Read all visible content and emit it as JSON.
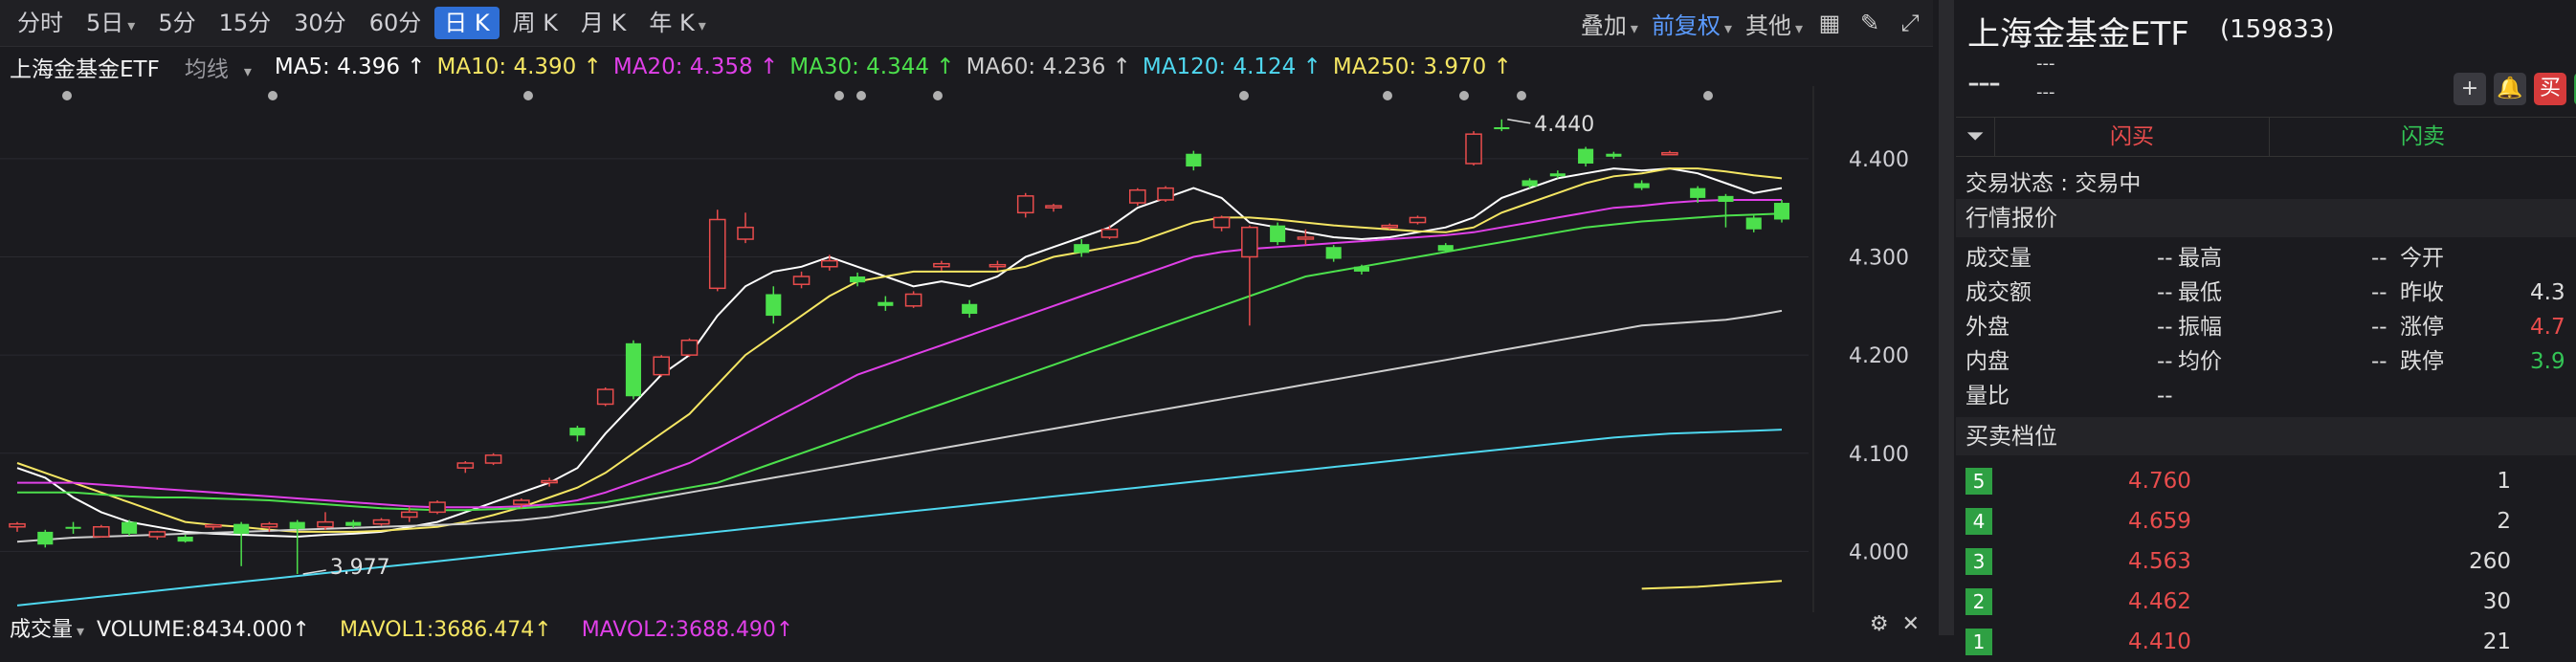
{
  "toolbar": {
    "periods": [
      "分时",
      "5日",
      "5分",
      "15分",
      "30分",
      "60分",
      "日 K",
      "周 K",
      "月 K",
      "年 K"
    ],
    "period_dropdowns": [
      false,
      true,
      false,
      false,
      false,
      false,
      false,
      false,
      false,
      true
    ],
    "active_period": "日 K",
    "overlay_label": "叠加",
    "adjust_label": "前复权",
    "other_label": "其他"
  },
  "ma_bar": {
    "stock_name": "上海金基金ETF",
    "line_type": "均线",
    "items": [
      {
        "label": "MA5: 4.396 ↑",
        "color": "#ffffff"
      },
      {
        "label": "MA10: 4.390 ↑",
        "color": "#f5e663"
      },
      {
        "label": "MA20: 4.358 ↑",
        "color": "#e040e8"
      },
      {
        "label": "MA30: 4.344 ↑",
        "color": "#4ce04c"
      },
      {
        "label": "MA60: 4.236 ↑",
        "color": "#cfcfcf"
      },
      {
        "label": "MA120: 4.124 ↑",
        "color": "#4fd8f0"
      },
      {
        "label": "MA250: 3.970 ↑",
        "color": "#f5e663"
      }
    ]
  },
  "chart_data": {
    "type": "candlestick",
    "ylim": [
      3.94,
      4.47
    ],
    "y_ticks": [
      "4.400",
      "4.300",
      "4.200",
      "4.100",
      "4.000"
    ],
    "y_tick_values": [
      4.4,
      4.3,
      4.2,
      4.1,
      4.0
    ],
    "high_annotation": "4.440",
    "low_annotation": "3.977",
    "candles": [
      {
        "o": 4.025,
        "c": 4.028,
        "h": 4.03,
        "l": 4.02
      },
      {
        "o": 4.02,
        "c": 4.007,
        "h": 4.022,
        "l": 4.004
      },
      {
        "o": 4.025,
        "c": 4.024,
        "h": 4.03,
        "l": 4.018
      },
      {
        "o": 4.015,
        "c": 4.025,
        "h": 4.027,
        "l": 4.014
      },
      {
        "o": 4.03,
        "c": 4.018,
        "h": 4.032,
        "l": 4.016
      },
      {
        "o": 4.015,
        "c": 4.02,
        "h": 4.021,
        "l": 4.012
      },
      {
        "o": 4.015,
        "c": 4.01,
        "h": 4.017,
        "l": 4.009
      },
      {
        "o": 4.025,
        "c": 4.027,
        "h": 4.028,
        "l": 4.022
      },
      {
        "o": 4.028,
        "c": 4.018,
        "h": 4.03,
        "l": 3.985
      },
      {
        "o": 4.025,
        "c": 4.028,
        "h": 4.03,
        "l": 4.02
      },
      {
        "o": 4.03,
        "c": 4.023,
        "h": 4.032,
        "l": 3.977
      },
      {
        "o": 4.025,
        "c": 4.03,
        "h": 4.04,
        "l": 4.022
      },
      {
        "o": 4.03,
        "c": 4.026,
        "h": 4.032,
        "l": 4.024
      },
      {
        "o": 4.028,
        "c": 4.032,
        "h": 4.034,
        "l": 4.026
      },
      {
        "o": 4.035,
        "c": 4.04,
        "h": 4.045,
        "l": 4.03
      },
      {
        "o": 4.04,
        "c": 4.05,
        "h": 4.052,
        "l": 4.038
      },
      {
        "o": 4.085,
        "c": 4.09,
        "h": 4.092,
        "l": 4.08
      },
      {
        "o": 4.09,
        "c": 4.098,
        "h": 4.1,
        "l": 4.088
      },
      {
        "o": 4.048,
        "c": 4.052,
        "h": 4.054,
        "l": 4.044
      },
      {
        "o": 4.07,
        "c": 4.072,
        "h": 4.075,
        "l": 4.066
      },
      {
        "o": 4.126,
        "c": 4.118,
        "h": 4.128,
        "l": 4.112
      },
      {
        "o": 4.15,
        "c": 4.165,
        "h": 4.167,
        "l": 4.148
      },
      {
        "o": 4.212,
        "c": 4.158,
        "h": 4.215,
        "l": 4.155
      },
      {
        "o": 4.18,
        "c": 4.198,
        "h": 4.2,
        "l": 4.178
      },
      {
        "o": 4.2,
        "c": 4.215,
        "h": 4.217,
        "l": 4.198
      },
      {
        "o": 4.268,
        "c": 4.338,
        "h": 4.348,
        "l": 4.265
      },
      {
        "o": 4.318,
        "c": 4.33,
        "h": 4.345,
        "l": 4.314
      },
      {
        "o": 4.262,
        "c": 4.24,
        "h": 4.27,
        "l": 4.232
      },
      {
        "o": 4.272,
        "c": 4.28,
        "h": 4.285,
        "l": 4.268
      },
      {
        "o": 4.29,
        "c": 4.296,
        "h": 4.302,
        "l": 4.286
      },
      {
        "o": 4.28,
        "c": 4.274,
        "h": 4.284,
        "l": 4.27
      },
      {
        "o": 4.254,
        "c": 4.25,
        "h": 4.26,
        "l": 4.245
      },
      {
        "o": 4.25,
        "c": 4.262,
        "h": 4.265,
        "l": 4.248
      },
      {
        "o": 4.29,
        "c": 4.293,
        "h": 4.296,
        "l": 4.286
      },
      {
        "o": 4.252,
        "c": 4.242,
        "h": 4.256,
        "l": 4.238
      },
      {
        "o": 4.29,
        "c": 4.292,
        "h": 4.296,
        "l": 4.286
      },
      {
        "o": 4.345,
        "c": 4.362,
        "h": 4.365,
        "l": 4.34
      },
      {
        "o": 4.35,
        "c": 4.352,
        "h": 4.354,
        "l": 4.346
      },
      {
        "o": 4.313,
        "c": 4.304,
        "h": 4.318,
        "l": 4.3
      },
      {
        "o": 4.32,
        "c": 4.328,
        "h": 4.332,
        "l": 4.318
      },
      {
        "o": 4.355,
        "c": 4.368,
        "h": 4.37,
        "l": 4.352
      },
      {
        "o": 4.358,
        "c": 4.37,
        "h": 4.372,
        "l": 4.356
      },
      {
        "o": 4.405,
        "c": 4.392,
        "h": 4.408,
        "l": 4.388
      },
      {
        "o": 4.33,
        "c": 4.34,
        "h": 4.342,
        "l": 4.326
      },
      {
        "o": 4.3,
        "c": 4.33,
        "h": 4.332,
        "l": 4.23
      },
      {
        "o": 4.332,
        "c": 4.315,
        "h": 4.335,
        "l": 4.312
      },
      {
        "o": 4.32,
        "c": 4.32,
        "h": 4.328,
        "l": 4.312
      },
      {
        "o": 4.31,
        "c": 4.298,
        "h": 4.312,
        "l": 4.295
      },
      {
        "o": 4.29,
        "c": 4.285,
        "h": 4.292,
        "l": 4.282
      },
      {
        "o": 4.33,
        "c": 4.332,
        "h": 4.334,
        "l": 4.328
      },
      {
        "o": 4.335,
        "c": 4.34,
        "h": 4.342,
        "l": 4.333
      },
      {
        "o": 4.312,
        "c": 4.306,
        "h": 4.314,
        "l": 4.304
      },
      {
        "o": 4.395,
        "c": 4.425,
        "h": 4.428,
        "l": 4.393
      },
      {
        "o": 4.432,
        "c": 4.43,
        "h": 4.44,
        "l": 4.428
      },
      {
        "o": 4.378,
        "c": 4.372,
        "h": 4.38,
        "l": 4.37
      },
      {
        "o": 4.385,
        "c": 4.382,
        "h": 4.388,
        "l": 4.38
      },
      {
        "o": 4.41,
        "c": 4.395,
        "h": 4.412,
        "l": 4.392
      },
      {
        "o": 4.405,
        "c": 4.402,
        "h": 4.407,
        "l": 4.4
      },
      {
        "o": 4.375,
        "c": 4.37,
        "h": 4.378,
        "l": 4.368
      },
      {
        "o": 4.406,
        "c": 4.406,
        "h": 4.408,
        "l": 4.404
      },
      {
        "o": 4.37,
        "c": 4.36,
        "h": 4.372,
        "l": 4.355
      },
      {
        "o": 4.362,
        "c": 4.356,
        "h": 4.364,
        "l": 4.33
      },
      {
        "o": 4.34,
        "c": 4.328,
        "h": 4.342,
        "l": 4.325
      },
      {
        "o": 4.355,
        "c": 4.338,
        "h": 4.358,
        "l": 4.335
      }
    ],
    "ma_lines": {
      "ma5": [
        4.085,
        4.075,
        4.055,
        4.04,
        4.03,
        4.025,
        4.02,
        4.018,
        4.017,
        4.016,
        4.015,
        4.017,
        4.018,
        4.02,
        4.025,
        4.03,
        4.04,
        4.05,
        4.06,
        4.07,
        4.085,
        4.12,
        4.15,
        4.18,
        4.2,
        4.24,
        4.27,
        4.285,
        4.29,
        4.3,
        4.29,
        4.28,
        4.27,
        4.275,
        4.27,
        4.28,
        4.3,
        4.31,
        4.32,
        4.33,
        4.35,
        4.36,
        4.37,
        4.36,
        4.335,
        4.33,
        4.325,
        4.32,
        4.318,
        4.32,
        4.325,
        4.33,
        4.34,
        4.36,
        4.37,
        4.38,
        4.385,
        4.39,
        4.388,
        4.39,
        4.385,
        4.375,
        4.365,
        4.37
      ],
      "ma10": [
        4.09,
        4.08,
        4.07,
        4.06,
        4.05,
        4.04,
        4.03,
        4.027,
        4.025,
        4.022,
        4.02,
        4.02,
        4.02,
        4.021,
        4.023,
        4.025,
        4.03,
        4.037,
        4.045,
        4.055,
        4.065,
        4.08,
        4.1,
        4.12,
        4.14,
        4.17,
        4.2,
        4.22,
        4.24,
        4.26,
        4.275,
        4.28,
        4.285,
        4.285,
        4.285,
        4.285,
        4.29,
        4.3,
        4.305,
        4.31,
        4.315,
        4.325,
        4.335,
        4.34,
        4.34,
        4.338,
        4.335,
        4.332,
        4.33,
        4.328,
        4.326,
        4.325,
        4.33,
        4.345,
        4.355,
        4.365,
        4.375,
        4.382,
        4.385,
        4.39,
        4.39,
        4.387,
        4.383,
        4.38
      ],
      "ma20": [
        4.07,
        4.07,
        4.07,
        4.068,
        4.066,
        4.064,
        4.062,
        4.06,
        4.058,
        4.056,
        4.054,
        4.052,
        4.05,
        4.048,
        4.046,
        4.045,
        4.045,
        4.045,
        4.046,
        4.048,
        4.052,
        4.06,
        4.07,
        4.08,
        4.09,
        4.105,
        4.12,
        4.135,
        4.15,
        4.165,
        4.18,
        4.19,
        4.2,
        4.21,
        4.22,
        4.23,
        4.24,
        4.25,
        4.26,
        4.27,
        4.28,
        4.29,
        4.3,
        4.305,
        4.308,
        4.31,
        4.312,
        4.314,
        4.316,
        4.318,
        4.32,
        4.322,
        4.325,
        4.33,
        4.335,
        4.34,
        4.345,
        4.35,
        4.352,
        4.355,
        4.357,
        4.358,
        4.358,
        4.358
      ],
      "ma30": [
        4.06,
        4.06,
        4.06,
        4.058,
        4.056,
        4.055,
        4.055,
        4.054,
        4.053,
        4.052,
        4.05,
        4.048,
        4.046,
        4.044,
        4.043,
        4.042,
        4.042,
        4.043,
        4.044,
        4.046,
        4.048,
        4.05,
        4.055,
        4.06,
        4.065,
        4.07,
        4.08,
        4.09,
        4.1,
        4.11,
        4.12,
        4.13,
        4.14,
        4.15,
        4.16,
        4.17,
        4.18,
        4.19,
        4.2,
        4.21,
        4.22,
        4.23,
        4.24,
        4.25,
        4.26,
        4.27,
        4.28,
        4.285,
        4.29,
        4.295,
        4.3,
        4.305,
        4.31,
        4.315,
        4.32,
        4.325,
        4.33,
        4.333,
        4.336,
        4.338,
        4.34,
        4.342,
        4.343,
        4.344
      ],
      "ma60": [
        4.01,
        4.012,
        4.014,
        4.015,
        4.016,
        4.017,
        4.018,
        4.019,
        4.02,
        4.021,
        4.022,
        4.023,
        4.024,
        4.025,
        4.026,
        4.027,
        4.028,
        4.03,
        4.032,
        4.035,
        4.04,
        4.045,
        4.05,
        4.055,
        4.06,
        4.065,
        4.07,
        4.075,
        4.08,
        4.085,
        4.09,
        4.095,
        4.1,
        4.105,
        4.11,
        4.115,
        4.12,
        4.125,
        4.13,
        4.135,
        4.14,
        4.145,
        4.15,
        4.155,
        4.16,
        4.165,
        4.17,
        4.175,
        4.18,
        4.185,
        4.19,
        4.195,
        4.2,
        4.205,
        4.21,
        4.215,
        4.22,
        4.225,
        4.23,
        4.232,
        4.234,
        4.236,
        4.24,
        4.245
      ],
      "ma120": [
        3.945,
        3.948,
        3.951,
        3.954,
        3.957,
        3.96,
        3.963,
        3.966,
        3.969,
        3.972,
        3.975,
        3.978,
        3.981,
        3.984,
        3.987,
        3.99,
        3.993,
        3.996,
        3.999,
        4.002,
        4.005,
        4.008,
        4.011,
        4.014,
        4.017,
        4.02,
        4.023,
        4.026,
        4.029,
        4.032,
        4.035,
        4.038,
        4.041,
        4.044,
        4.047,
        4.05,
        4.053,
        4.056,
        4.059,
        4.062,
        4.065,
        4.068,
        4.071,
        4.074,
        4.077,
        4.08,
        4.083,
        4.086,
        4.089,
        4.092,
        4.095,
        4.098,
        4.101,
        4.104,
        4.107,
        4.11,
        4.113,
        4.116,
        4.118,
        4.12,
        4.121,
        4.122,
        4.123,
        4.124
      ],
      "ma250_start_index": 58,
      "ma250": [
        3.962,
        3.963,
        3.964,
        3.966,
        3.968,
        3.97
      ]
    }
  },
  "volume_bar": {
    "label": "成交量",
    "volume": "VOLUME:8434.000↑",
    "mavol1": "MAVOL1:3686.474↑",
    "mavol2": "MAVOL2:3688.490↑"
  },
  "right_panel": {
    "title": "上海金基金ETF",
    "code": "(159833)",
    "price": "---",
    "change1": "---",
    "change2": "---",
    "flash_buy": "闪买",
    "flash_sell": "闪卖",
    "trade_status": "交易状态 : 交易中",
    "quote_header": "行情报价",
    "quotes": [
      [
        {
          "k": "成交量",
          "v": "--"
        },
        {
          "k": "最高",
          "v": "--"
        },
        {
          "k": "今开",
          "v": ""
        }
      ],
      [
        {
          "k": "成交额",
          "v": "--"
        },
        {
          "k": "最低",
          "v": "--"
        },
        {
          "k": "昨收",
          "v": "4.3"
        }
      ],
      [
        {
          "k": "外盘",
          "v": "--"
        },
        {
          "k": "振幅",
          "v": "--"
        },
        {
          "k": "涨停",
          "v": "4.7"
        }
      ],
      [
        {
          "k": "内盘",
          "v": "--"
        },
        {
          "k": "均价",
          "v": "--"
        },
        {
          "k": "跌停",
          "v": "3.9"
        }
      ],
      [
        {
          "k": "量比",
          "v": "--"
        }
      ]
    ],
    "levels_header": "买卖档位",
    "levels": [
      {
        "n": "5",
        "price": "4.760",
        "vol": "1"
      },
      {
        "n": "4",
        "price": "4.659",
        "vol": "2"
      },
      {
        "n": "3",
        "price": "4.563",
        "vol": "260"
      },
      {
        "n": "2",
        "price": "4.462",
        "vol": "30"
      },
      {
        "n": "1",
        "price": "4.410",
        "vol": "21"
      }
    ],
    "colors": {
      "up": "#e84c4c",
      "down": "#33c455",
      "accent": "#2f6fd6"
    }
  }
}
